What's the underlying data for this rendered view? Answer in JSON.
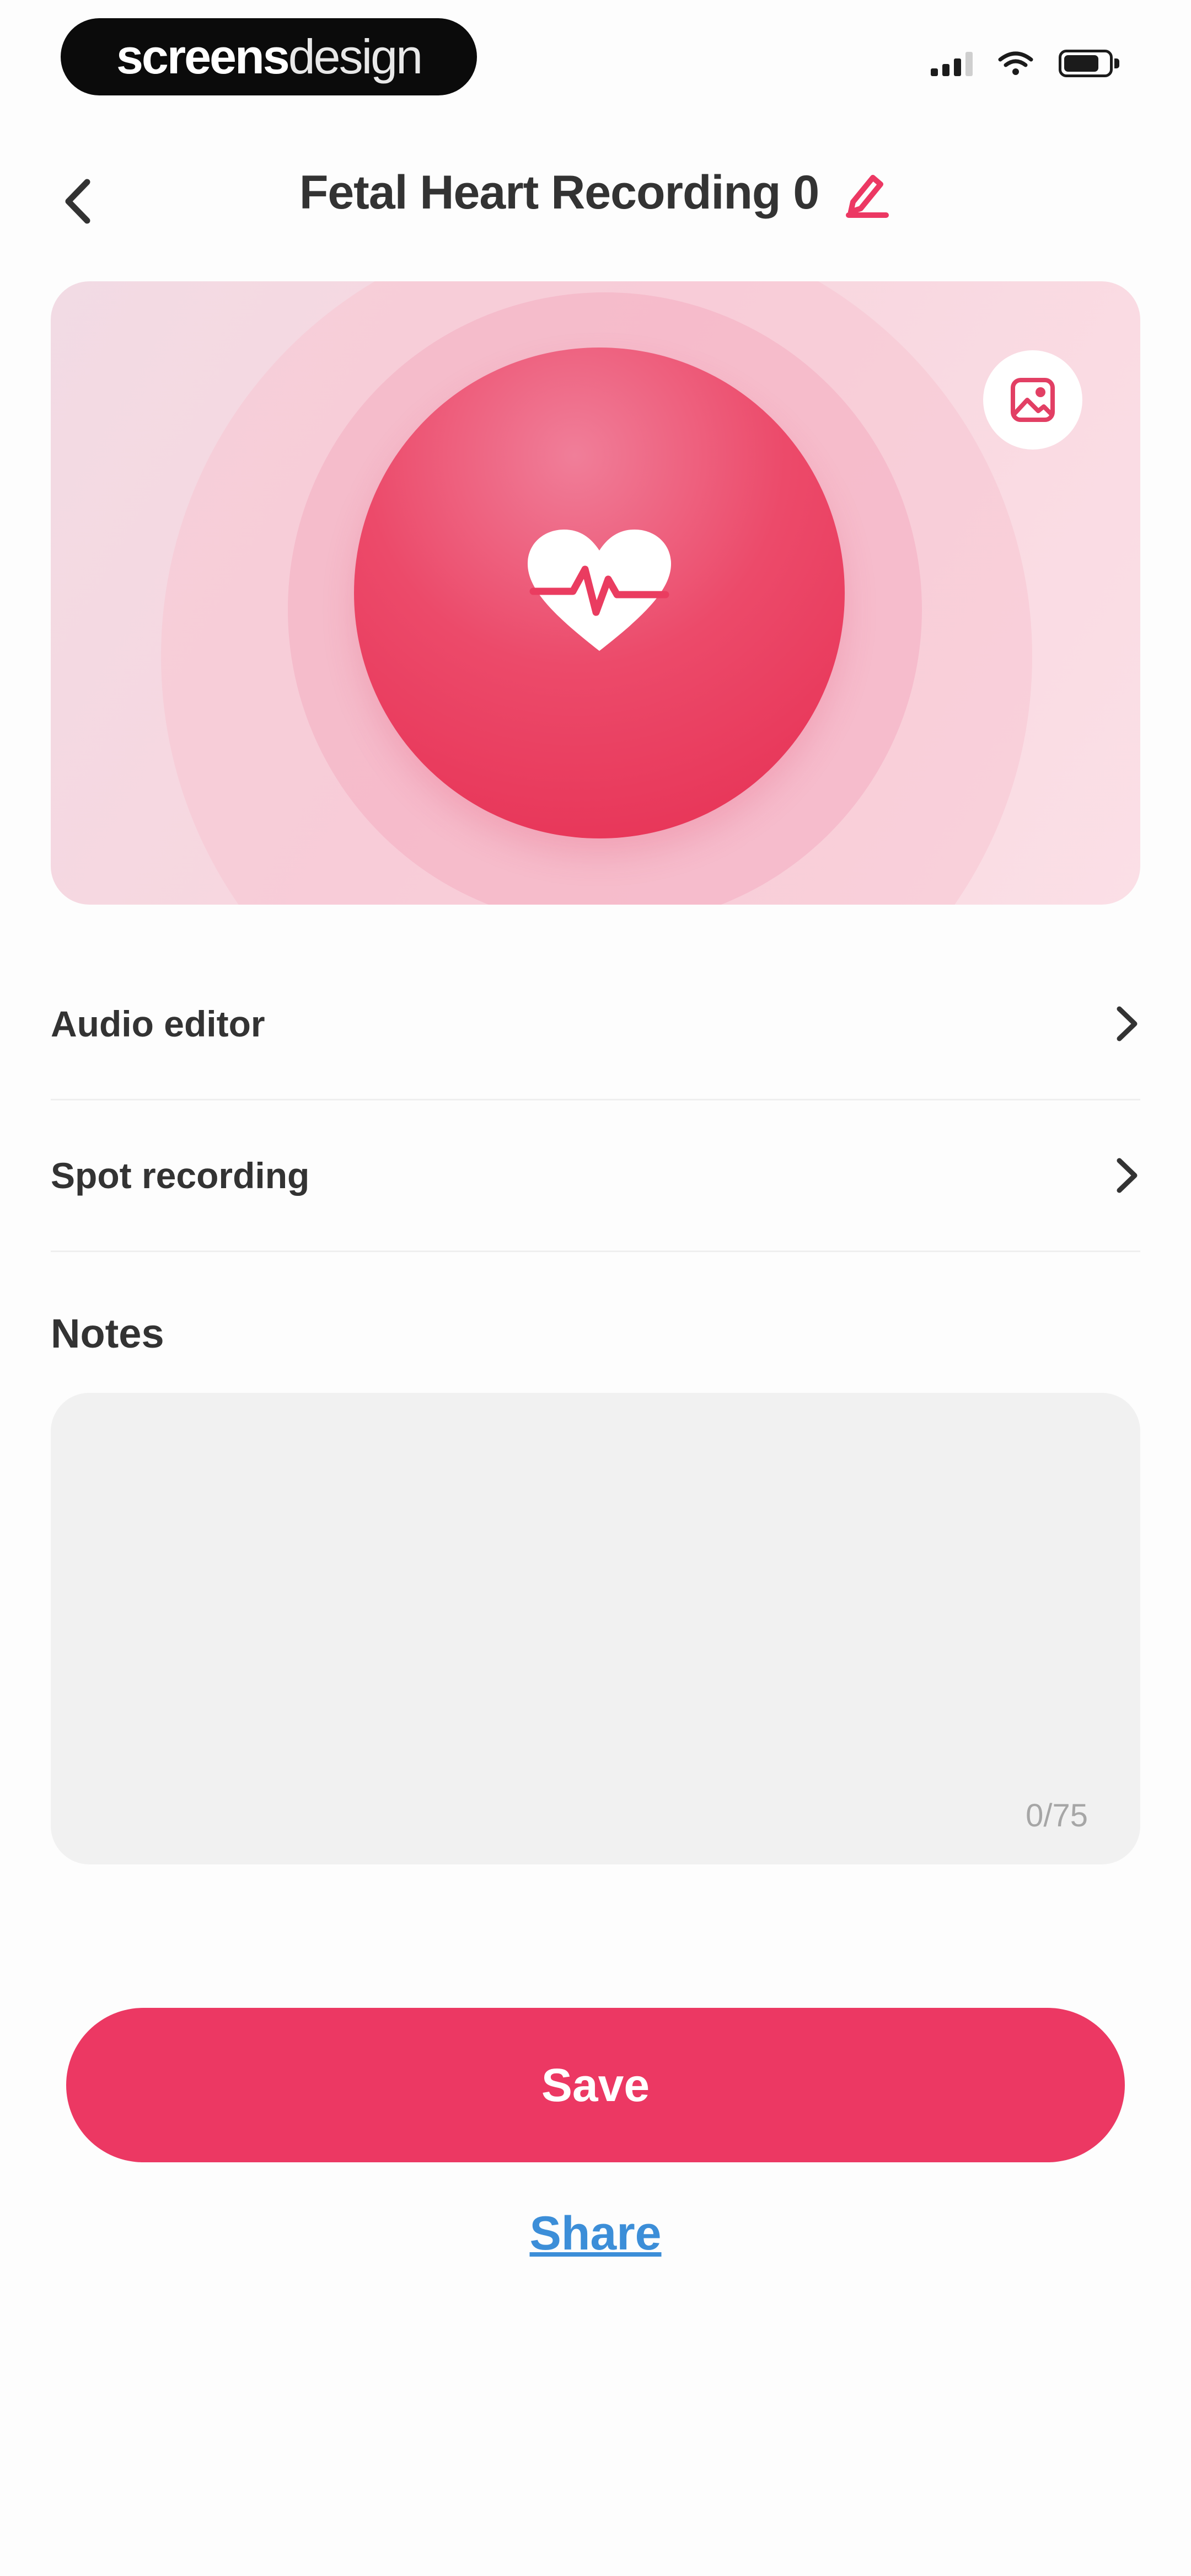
{
  "status_bar": {
    "brand_strong": "screens",
    "brand_light": "design"
  },
  "nav": {
    "title": "Fetal Heart Recording 0"
  },
  "menu": {
    "items": [
      {
        "label": "Audio editor"
      },
      {
        "label": "Spot recording"
      }
    ]
  },
  "notes": {
    "title": "Notes",
    "value": "",
    "counter": "0/75"
  },
  "actions": {
    "save_label": "Save",
    "share_label": "Share"
  },
  "colors": {
    "accent": "#ec3863",
    "link": "#3c8ed8",
    "hero_background": "#f8d6df"
  },
  "icons": [
    "back-chevron-icon",
    "edit-pencil-icon",
    "heartbeat-icon",
    "image-icon",
    "chevron-right-icon",
    "signal-icon",
    "wifi-icon",
    "battery-icon"
  ]
}
